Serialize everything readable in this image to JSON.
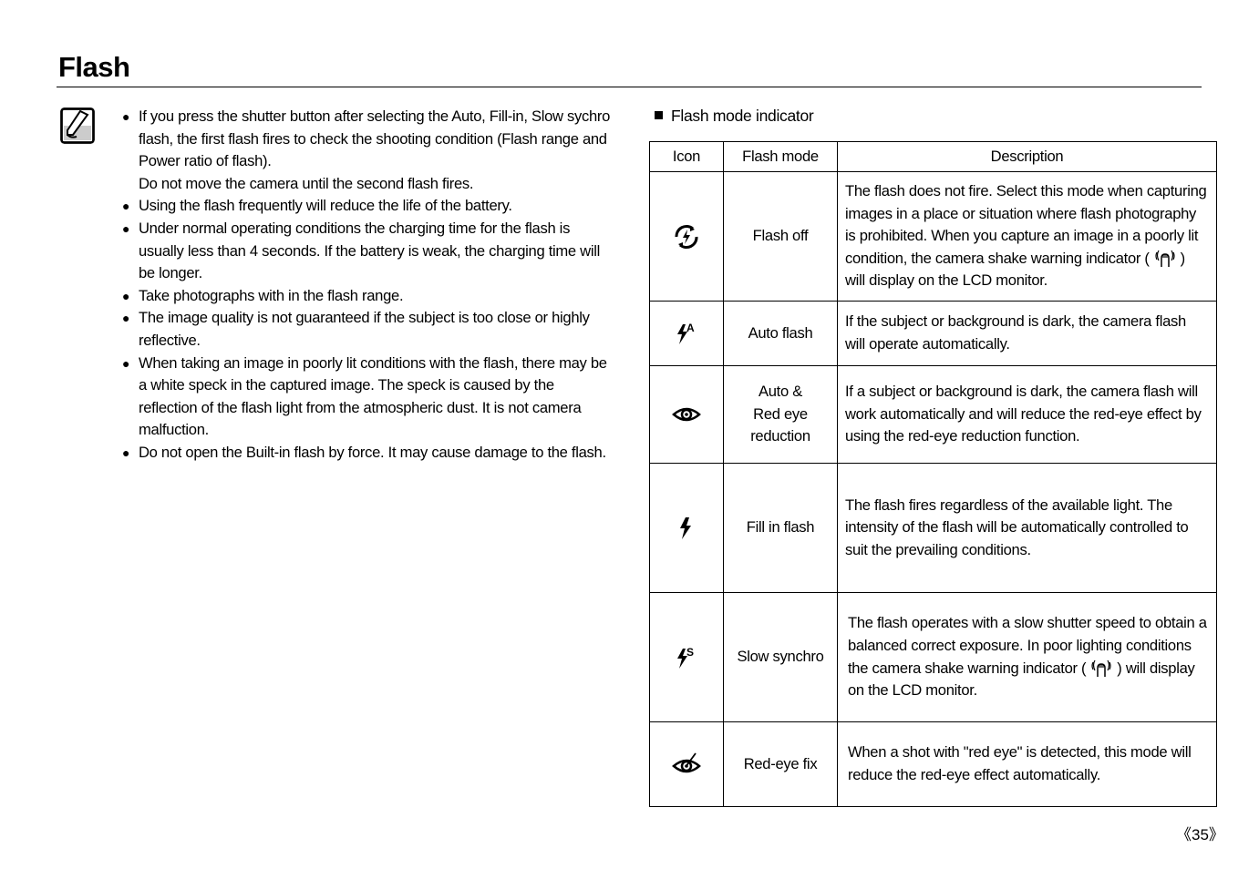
{
  "page": {
    "title": "Flash",
    "page_number": "《35》"
  },
  "notes": {
    "icon": "note-pencil-icon",
    "items": [
      {
        "text": "If you press the shutter button after selecting the Auto, Fill-in, Slow sychro flash, the first flash fires to check the shooting condition (Flash range and Power ratio of flash).",
        "sub": "Do not move the camera until the second flash fires."
      },
      {
        "text": "Using the flash frequently will reduce the life of the battery."
      },
      {
        "text": "Under normal operating conditions the charging time for the flash is usually less than 4 seconds. If the battery is weak, the charging time will be longer."
      },
      {
        "text": "Take photographs with in the flash range."
      },
      {
        "text": "The image quality is not guaranteed if the subject is too close or highly reflective."
      },
      {
        "text": "When taking an image in poorly lit conditions with the flash, there may be a white speck in the captured image. The speck is caused by the reflection of the flash light from the atmospheric dust. It is not camera malfuction."
      },
      {
        "text": "Do not open the Built-in flash by force. It may cause damage to the flash."
      }
    ]
  },
  "table": {
    "heading": "Flash mode indicator",
    "headers": [
      "Icon",
      "Flash mode",
      "Description"
    ],
    "rows": [
      {
        "icon": "flash-off-icon",
        "mode": "Flash off",
        "desc_a": "The flash does not fire. Select this mode when capturing images in a place or situation where flash photography is prohibited. When you capture an image in a poorly lit condition, the camera shake warning indicator (",
        "desc_b": ") will display on the LCD monitor."
      },
      {
        "icon": "auto-flash-icon",
        "mode": "Auto flash",
        "desc": "If the subject or background is dark, the camera flash will operate automatically."
      },
      {
        "icon": "red-eye-reduction-icon",
        "mode_lines": [
          "Auto &",
          "Red eye",
          "reduction"
        ],
        "desc": "If a subject or background is dark, the camera flash will work automatically and will reduce the red-eye effect by using the red-eye reduction function."
      },
      {
        "icon": "fill-in-flash-icon",
        "mode": "Fill in flash",
        "desc": "The flash fires regardless of the available light. The intensity of the flash will be automatically controlled to suit the prevailing conditions."
      },
      {
        "icon": "slow-synchro-icon",
        "mode": "Slow synchro",
        "desc_a": "The flash operates with a slow shutter speed to obtain a balanced correct exposure. In poor lighting conditions the camera shake warning indicator (",
        "desc_b": ") will display on the LCD monitor."
      },
      {
        "icon": "red-eye-fix-icon",
        "mode": "Red-eye fix",
        "desc": "When a shot with \"red eye\" is detected, this mode will reduce the red-eye effect automatically."
      }
    ]
  }
}
